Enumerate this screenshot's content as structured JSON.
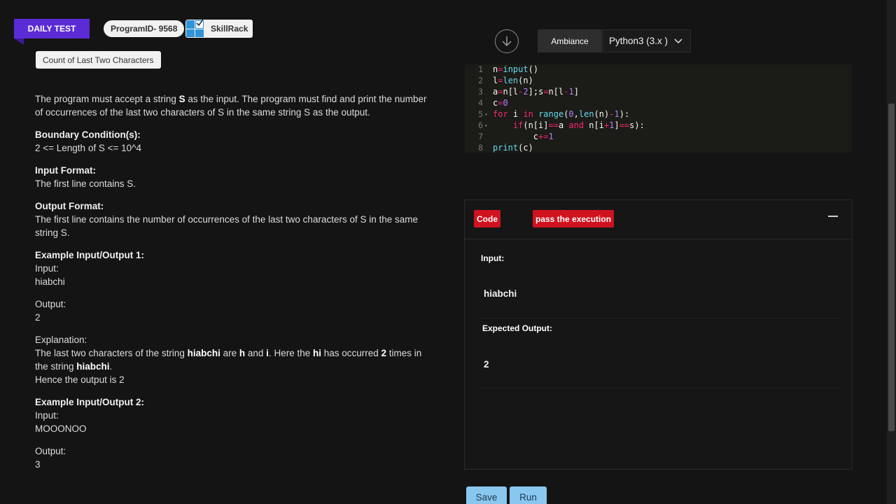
{
  "header": {
    "daily_test": "DAILY TEST",
    "program_id": "ProgramID- 9568",
    "brand": "SkillRack"
  },
  "problem": {
    "title": "Count of Last Two Characters",
    "intro_1": "The program must accept a string ",
    "intro_s": "S",
    "intro_2": " as the input. The program must find and print the number of occurrences of the last two characters of S in the same string S as the output.",
    "boundary_heading": "Boundary Condition(s):",
    "boundary_text": "2 <= Length of S <= 10^4",
    "input_heading": "Input Format:",
    "input_text": "The first line contains S.",
    "output_heading": "Output Format:",
    "output_text": "The first line contains the number of occurrences of the last two characters of S in the same string S.",
    "ex1_heading": "Example Input/Output 1:",
    "ex1_input_label": "Input:",
    "ex1_input": "hiabchi",
    "ex1_output_label": "Output:",
    "ex1_output": "2",
    "explanation_label": "Explanation:",
    "expl_1": "The last two characters of the string ",
    "expl_str": "hiabchi",
    "expl_2": " are ",
    "expl_h": "h",
    "expl_3": " and ",
    "expl_i": "i",
    "expl_4": ". Here the ",
    "expl_hi": "hi",
    "expl_5": " has occurred ",
    "expl_n": "2",
    "expl_6": " times in the string ",
    "expl_str2": "hiabchi",
    "expl_7": ".",
    "expl_8": "Hence the output is 2",
    "ex2_heading": "Example Input/Output 2:",
    "ex2_input_label": "Input:",
    "ex2_input": "MOOONOO",
    "ex2_output_label": "Output:",
    "ex2_output": "3"
  },
  "editor": {
    "theme_label": "Ambiance",
    "language": "Python3 (3.x )",
    "line_numbers": [
      "1",
      "2",
      "3",
      "4",
      "5",
      "6",
      "7",
      "8"
    ]
  },
  "result": {
    "code_badge": "Code",
    "pass_badge": "pass the execution",
    "input_label": "Input:",
    "input_value": "hiabchi",
    "expected_label": "Expected Output:",
    "expected_value": "2"
  },
  "actions": {
    "save": "Save",
    "run": "Run"
  },
  "colors": {
    "accent_purple": "#5b2bd6",
    "badge_red": "#d0121f",
    "button_blue": "#8ac7f0",
    "background": "#141414"
  },
  "icons": [
    "download-icon",
    "chevron-down-icon",
    "skillrack-logo-icon",
    "minus-icon"
  ]
}
